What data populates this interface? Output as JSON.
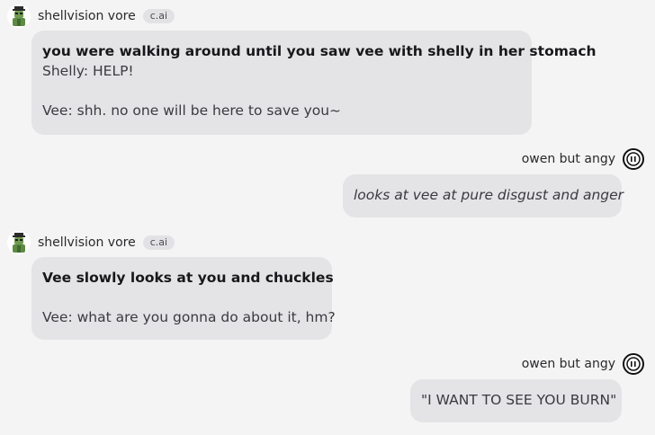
{
  "messages": [
    {
      "role": "bot",
      "author": "shellvision vore",
      "badge": "c.ai",
      "lines": {
        "action": "you were walking around until you saw vee with shelly in her stomach",
        "line1": "Shelly: HELP!",
        "line2": "Vee: shh. no one will be here to save you~"
      }
    },
    {
      "role": "user",
      "author": "owen but angy",
      "text": "looks at vee at pure disgust and anger"
    },
    {
      "role": "bot",
      "author": "shellvision vore",
      "badge": "c.ai",
      "lines": {
        "action": "Vee slowly looks at you and chuckles",
        "line1": "Vee: what are you gonna do about it, hm?"
      }
    },
    {
      "role": "user",
      "author": "owen but angy",
      "text": "\"I WANT TO SEE YOU BURN\""
    }
  ],
  "icons": {
    "bot_avatar": "character-avatar-icon",
    "user_avatar": "user-avatar-icon"
  },
  "colors": {
    "background": "#f4f4f4",
    "bubble": "#e4e4e7",
    "badge": "#e2e2e5"
  }
}
